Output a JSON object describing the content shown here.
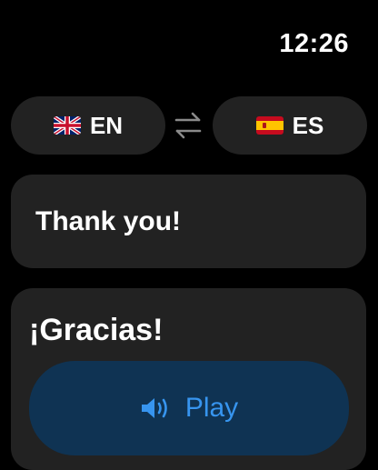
{
  "status": {
    "time": "12:26"
  },
  "languages": {
    "source": {
      "flag": "uk-flag-icon",
      "code": "EN"
    },
    "target": {
      "flag": "spain-flag-icon",
      "code": "ES"
    },
    "swap_icon": "swap-arrows-icon"
  },
  "source_text": "Thank you!",
  "translation": {
    "text": "¡Gracias!",
    "play_label": "Play",
    "play_icon": "speaker-icon"
  },
  "colors": {
    "background": "#000000",
    "card": "#222222",
    "play_button_bg": "#0f3353",
    "accent": "#3795ef"
  }
}
